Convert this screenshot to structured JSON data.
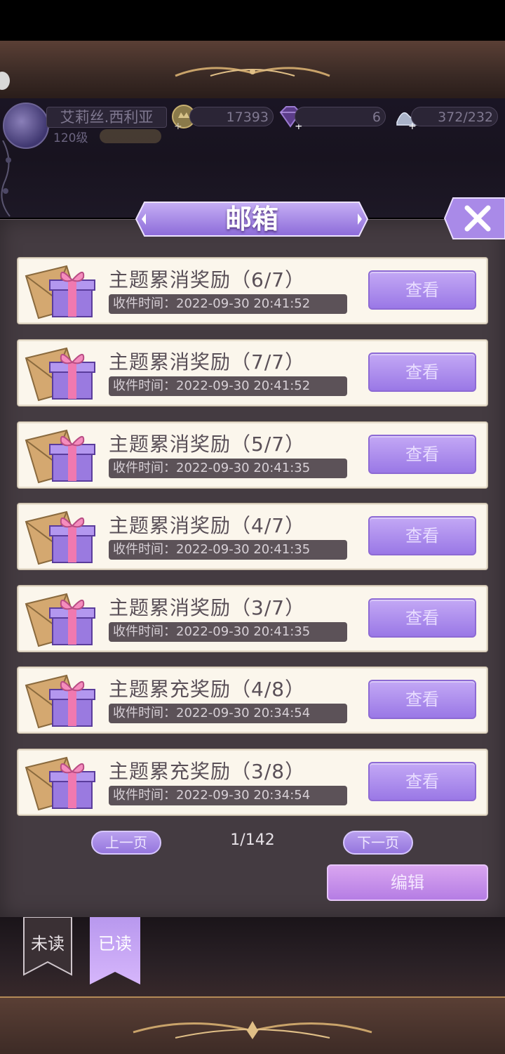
{
  "hud": {
    "player_name": "艾莉丝.西利亚",
    "player_level": "120级",
    "gold": "17393",
    "gems": "6",
    "stamina": "372/232"
  },
  "panel": {
    "title": "邮箱",
    "close_label": "X"
  },
  "mails": [
    {
      "title": "主题累消奖励（6/7）",
      "time": "收件时间：2022-09-30 20:41:52",
      "button": "查看"
    },
    {
      "title": "主题累消奖励（7/7）",
      "time": "收件时间：2022-09-30 20:41:52",
      "button": "查看"
    },
    {
      "title": "主题累消奖励（5/7）",
      "time": "收件时间：2022-09-30 20:41:35",
      "button": "查看"
    },
    {
      "title": "主题累消奖励（4/7）",
      "time": "收件时间：2022-09-30 20:41:35",
      "button": "查看"
    },
    {
      "title": "主题累消奖励（3/7）",
      "time": "收件时间：2022-09-30 20:41:35",
      "button": "查看"
    },
    {
      "title": "主题累充奖励（4/8）",
      "time": "收件时间：2022-09-30 20:34:54",
      "button": "查看"
    },
    {
      "title": "主题累充奖励（3/8）",
      "time": "收件时间：2022-09-30 20:34:54",
      "button": "查看"
    }
  ],
  "pager": {
    "prev": "上一页",
    "page": "1/142",
    "next": "下一页"
  },
  "edit_label": "编辑",
  "tabs": {
    "unread": "未读",
    "read": "已读"
  },
  "colors": {
    "accent_purple": "#9a78e6",
    "panel_bg": "#443b41",
    "card_bg": "#fbf6ec",
    "frame_gold": "#b48a57"
  }
}
